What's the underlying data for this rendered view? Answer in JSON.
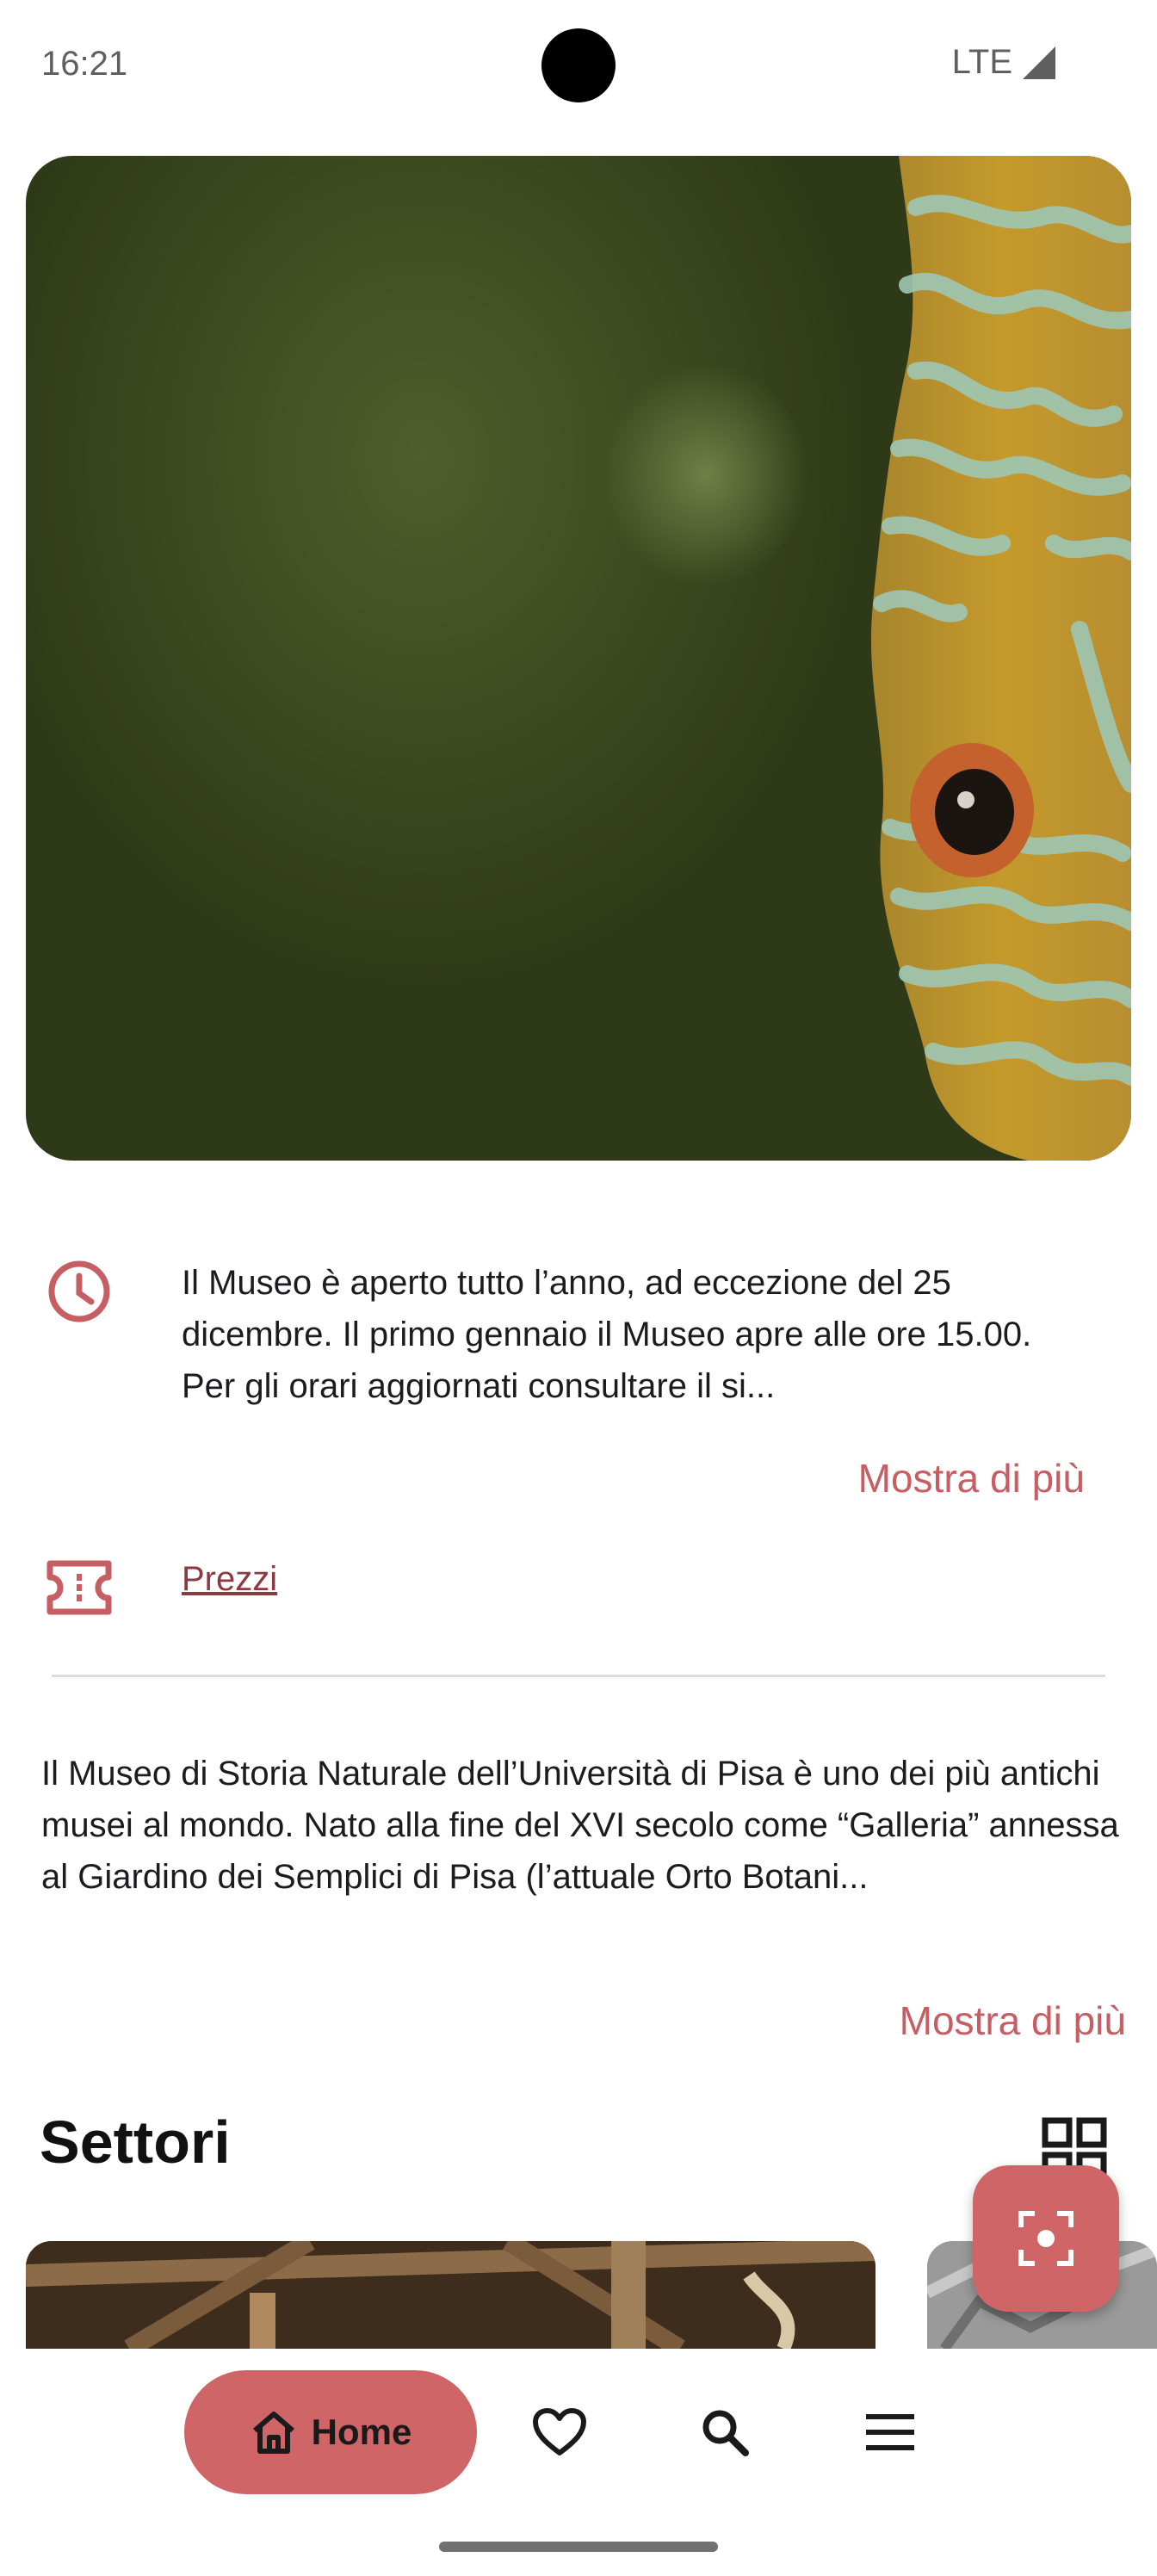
{
  "status_bar": {
    "time": "16:21",
    "network": "LTE",
    "signal_icon": "signal-icon"
  },
  "hero": {
    "image": "discus-fish-closeup-photo"
  },
  "hours": {
    "icon": "clock-icon",
    "text": "Il Museo è aperto tutto l’anno, ad eccezione del 25 dicembre. Il primo gennaio il Museo apre alle ore 15.00. Per gli orari aggiornati consultare il si...",
    "more_label": "Mostra di più"
  },
  "prices": {
    "icon": "ticket-icon",
    "label": "Prezzi"
  },
  "about": {
    "text": "Il Museo di Storia Naturale dell’Università di Pisa è uno dei più antichi musei al mondo. Nato alla fine del XVI secolo come “Galleria” annessa al Giardino dei Semplici di Pisa (l’attuale Orto Botani...",
    "more_label": "Mostra di più"
  },
  "sectors": {
    "title": "Settori",
    "view_icon": "grid-view-icon"
  },
  "fab": {
    "icon": "qr-scan-icon"
  },
  "bottom_nav": {
    "items": [
      {
        "label": "Home",
        "icon": "home-icon",
        "active": true
      },
      {
        "icon": "heart-icon"
      },
      {
        "icon": "search-icon"
      },
      {
        "icon": "menu-icon"
      }
    ]
  },
  "colors": {
    "accent": "#d06568",
    "link_text": "#c75e63"
  }
}
